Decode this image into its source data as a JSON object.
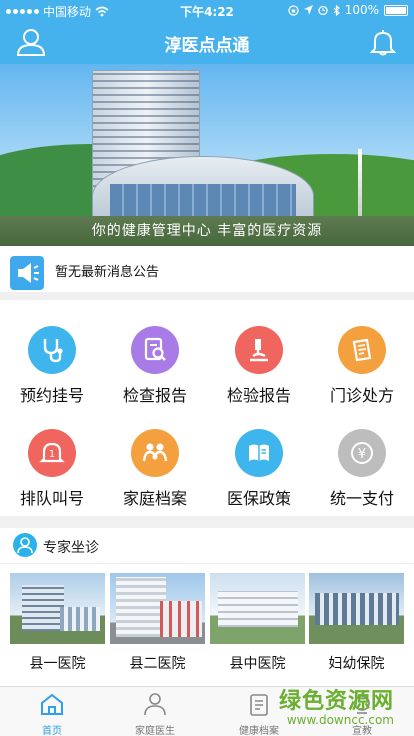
{
  "status_bar": {
    "carrier": "中国移动",
    "time": "下午4:22",
    "battery": "100%"
  },
  "nav": {
    "title": "淳医点点通"
  },
  "banner": {
    "caption": "你的健康管理中心    丰富的医疗资源"
  },
  "notice": {
    "text": "暂无最新消息公告"
  },
  "services": [
    {
      "label": "预约挂号",
      "icon": "stethoscope-icon",
      "color": "#3fb5ee"
    },
    {
      "label": "检查报告",
      "icon": "report-search-icon",
      "color": "#a87be6"
    },
    {
      "label": "检验报告",
      "icon": "microscope-icon",
      "color": "#f0655e"
    },
    {
      "label": "门诊处方",
      "icon": "prescription-icon",
      "color": "#f5a03f"
    },
    {
      "label": "排队叫号",
      "icon": "queue-bell-icon",
      "color": "#f0655e"
    },
    {
      "label": "家庭档案",
      "icon": "family-icon",
      "color": "#f5a03f"
    },
    {
      "label": "医保政策",
      "icon": "policy-book-icon",
      "color": "#3fb5ee"
    },
    {
      "label": "统一支付",
      "icon": "yuan-payment-icon",
      "color": "#bdbdbd"
    }
  ],
  "experts": {
    "title": "专家坐诊"
  },
  "hospitals": [
    {
      "name": "县一医院"
    },
    {
      "name": "县二医院"
    },
    {
      "name": "县中医院"
    },
    {
      "name": "妇幼保院"
    }
  ],
  "tabs": [
    {
      "label": "首页",
      "icon": "home-icon",
      "active": true
    },
    {
      "label": "家庭医生",
      "icon": "doctor-icon",
      "active": false
    },
    {
      "label": "健康档案",
      "icon": "clipboard-icon",
      "active": false
    },
    {
      "label": "宣教",
      "icon": "education-icon",
      "active": false
    }
  ],
  "watermark": {
    "line1": "绿色资源网",
    "line2": "www.downcc.com"
  },
  "colors": {
    "primary": "#45b2ee",
    "tab_active": "#2e9fe8"
  }
}
